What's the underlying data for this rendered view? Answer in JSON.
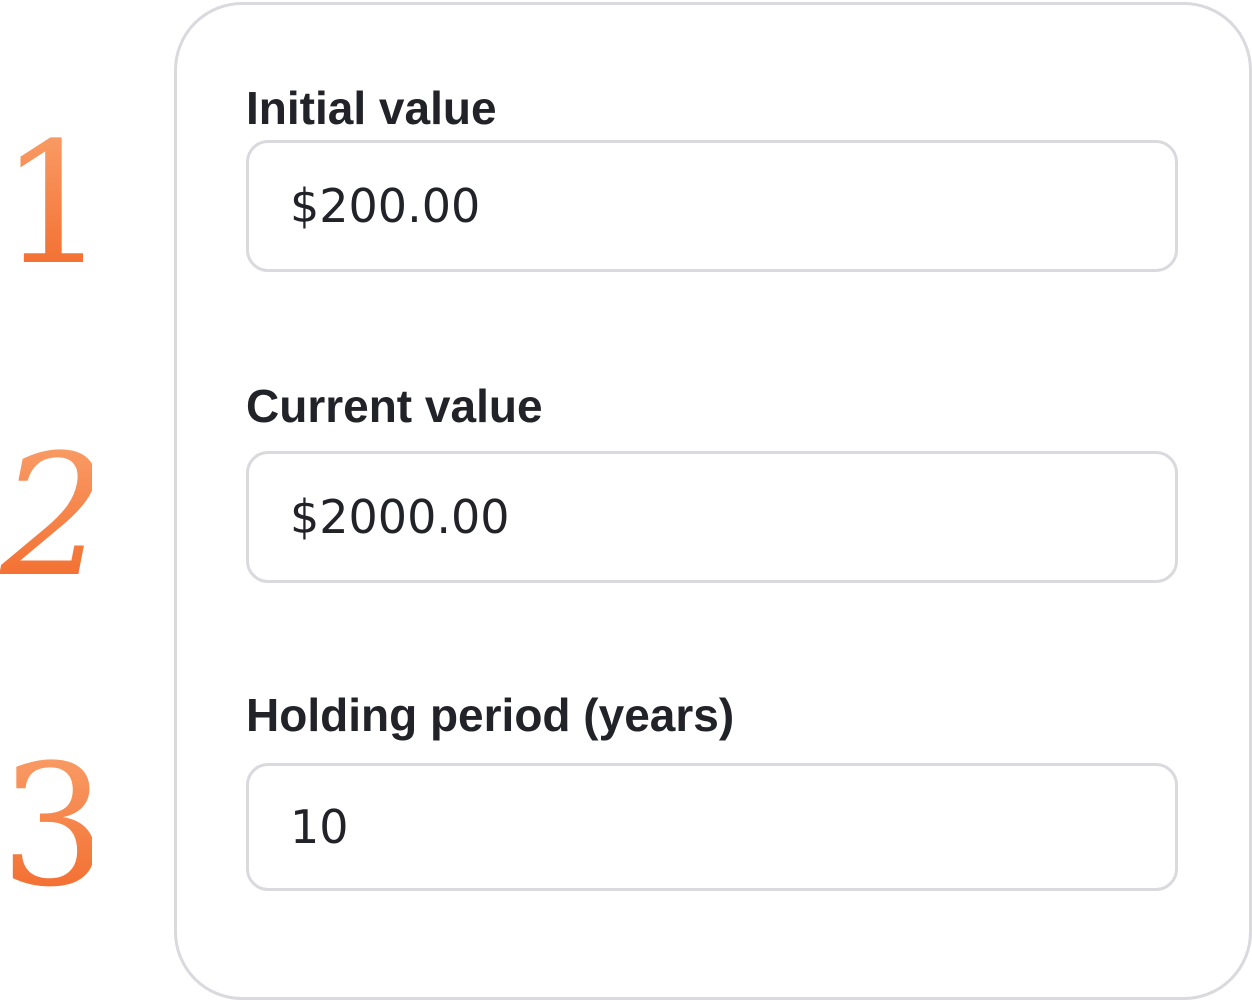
{
  "steps": [
    {
      "number": "1"
    },
    {
      "number": "2"
    },
    {
      "number": "3"
    }
  ],
  "form": {
    "fields": [
      {
        "label": "Initial value",
        "value": "$200.00"
      },
      {
        "label": "Current value",
        "value": "$2000.00"
      },
      {
        "label": "Holding period (years)",
        "value": "10"
      }
    ]
  },
  "colors": {
    "accent_orange": "#f47a3a",
    "border_gray": "#d9d9de",
    "text_dark": "#222329"
  }
}
